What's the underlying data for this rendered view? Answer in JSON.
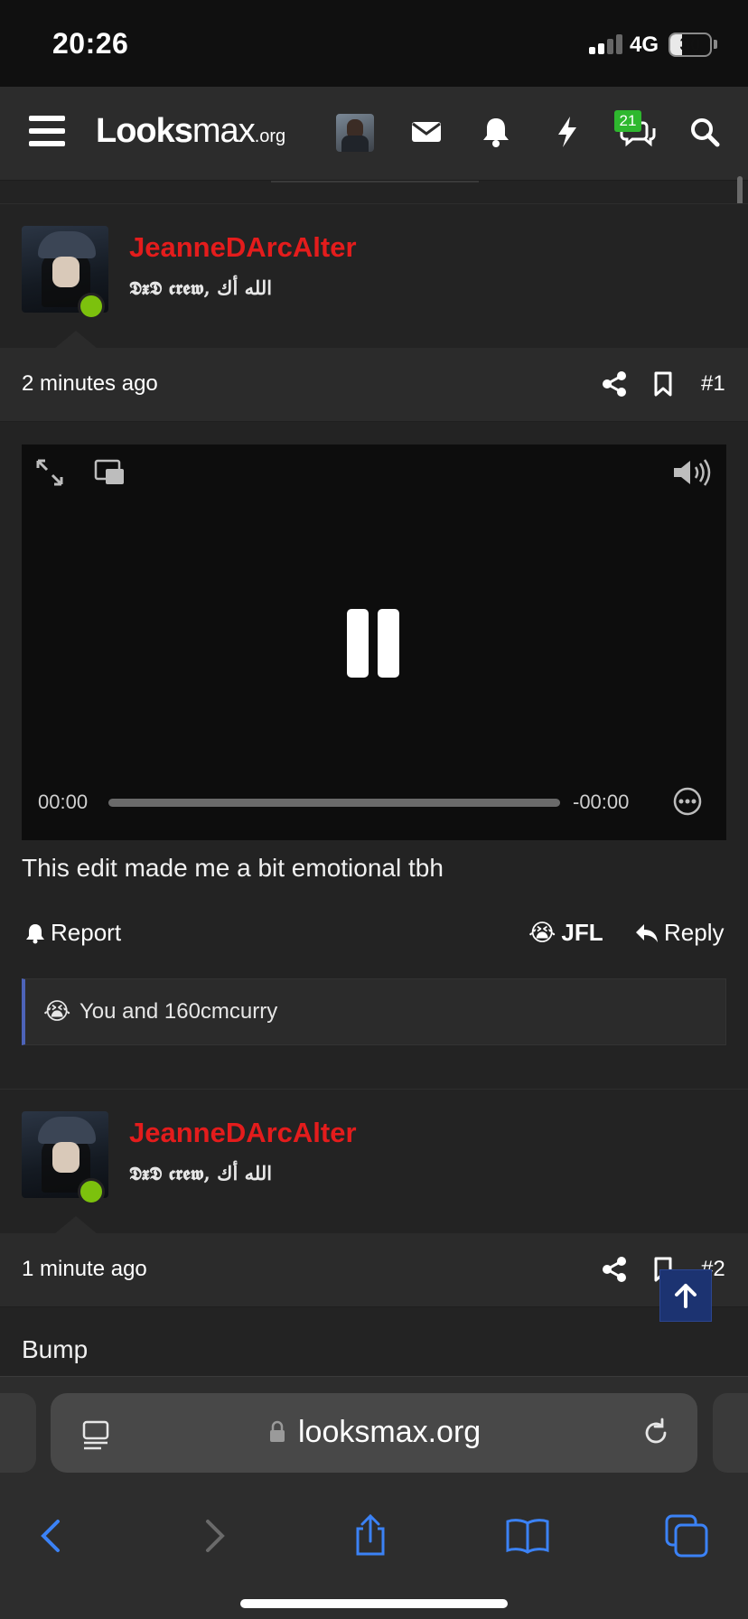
{
  "status_bar": {
    "time": "20:26",
    "network": "4G",
    "battery": "30"
  },
  "nav": {
    "logo_main": "Looks",
    "logo_light": "max",
    "logo_tld": ".org",
    "conversations_badge": "21"
  },
  "posts": [
    {
      "username": "JeanneDArcAlter",
      "user_title": "𝕯𝖝𝕯 𝖈𝖗𝖊𝖜, الله أك",
      "time": "2 minutes ago",
      "post_number": "#1",
      "video": {
        "current_time": "00:00",
        "remaining": "-00:00"
      },
      "text": "This edit made me a bit emotional tbh",
      "actions": {
        "report": "Report",
        "reaction": "JFL",
        "reply": "Reply"
      },
      "reactions_summary": "You and 160cmcurry",
      "reaction_emoji": "😭"
    },
    {
      "username": "JeanneDArcAlter",
      "user_title": "𝕯𝖝𝕯 𝖈𝖗𝖊𝖜, الله أك",
      "time": "1 minute ago",
      "post_number": "#2",
      "text": "Bump"
    }
  ],
  "browser": {
    "url": "looksmax.org"
  },
  "colors": {
    "username": "#e41c1c",
    "online": "#7cc10d",
    "badge": "#2eb82e",
    "accent_blue": "#3b82f6",
    "reaction_border": "#4d63b8",
    "scroll_top_bg": "#1c3371"
  }
}
